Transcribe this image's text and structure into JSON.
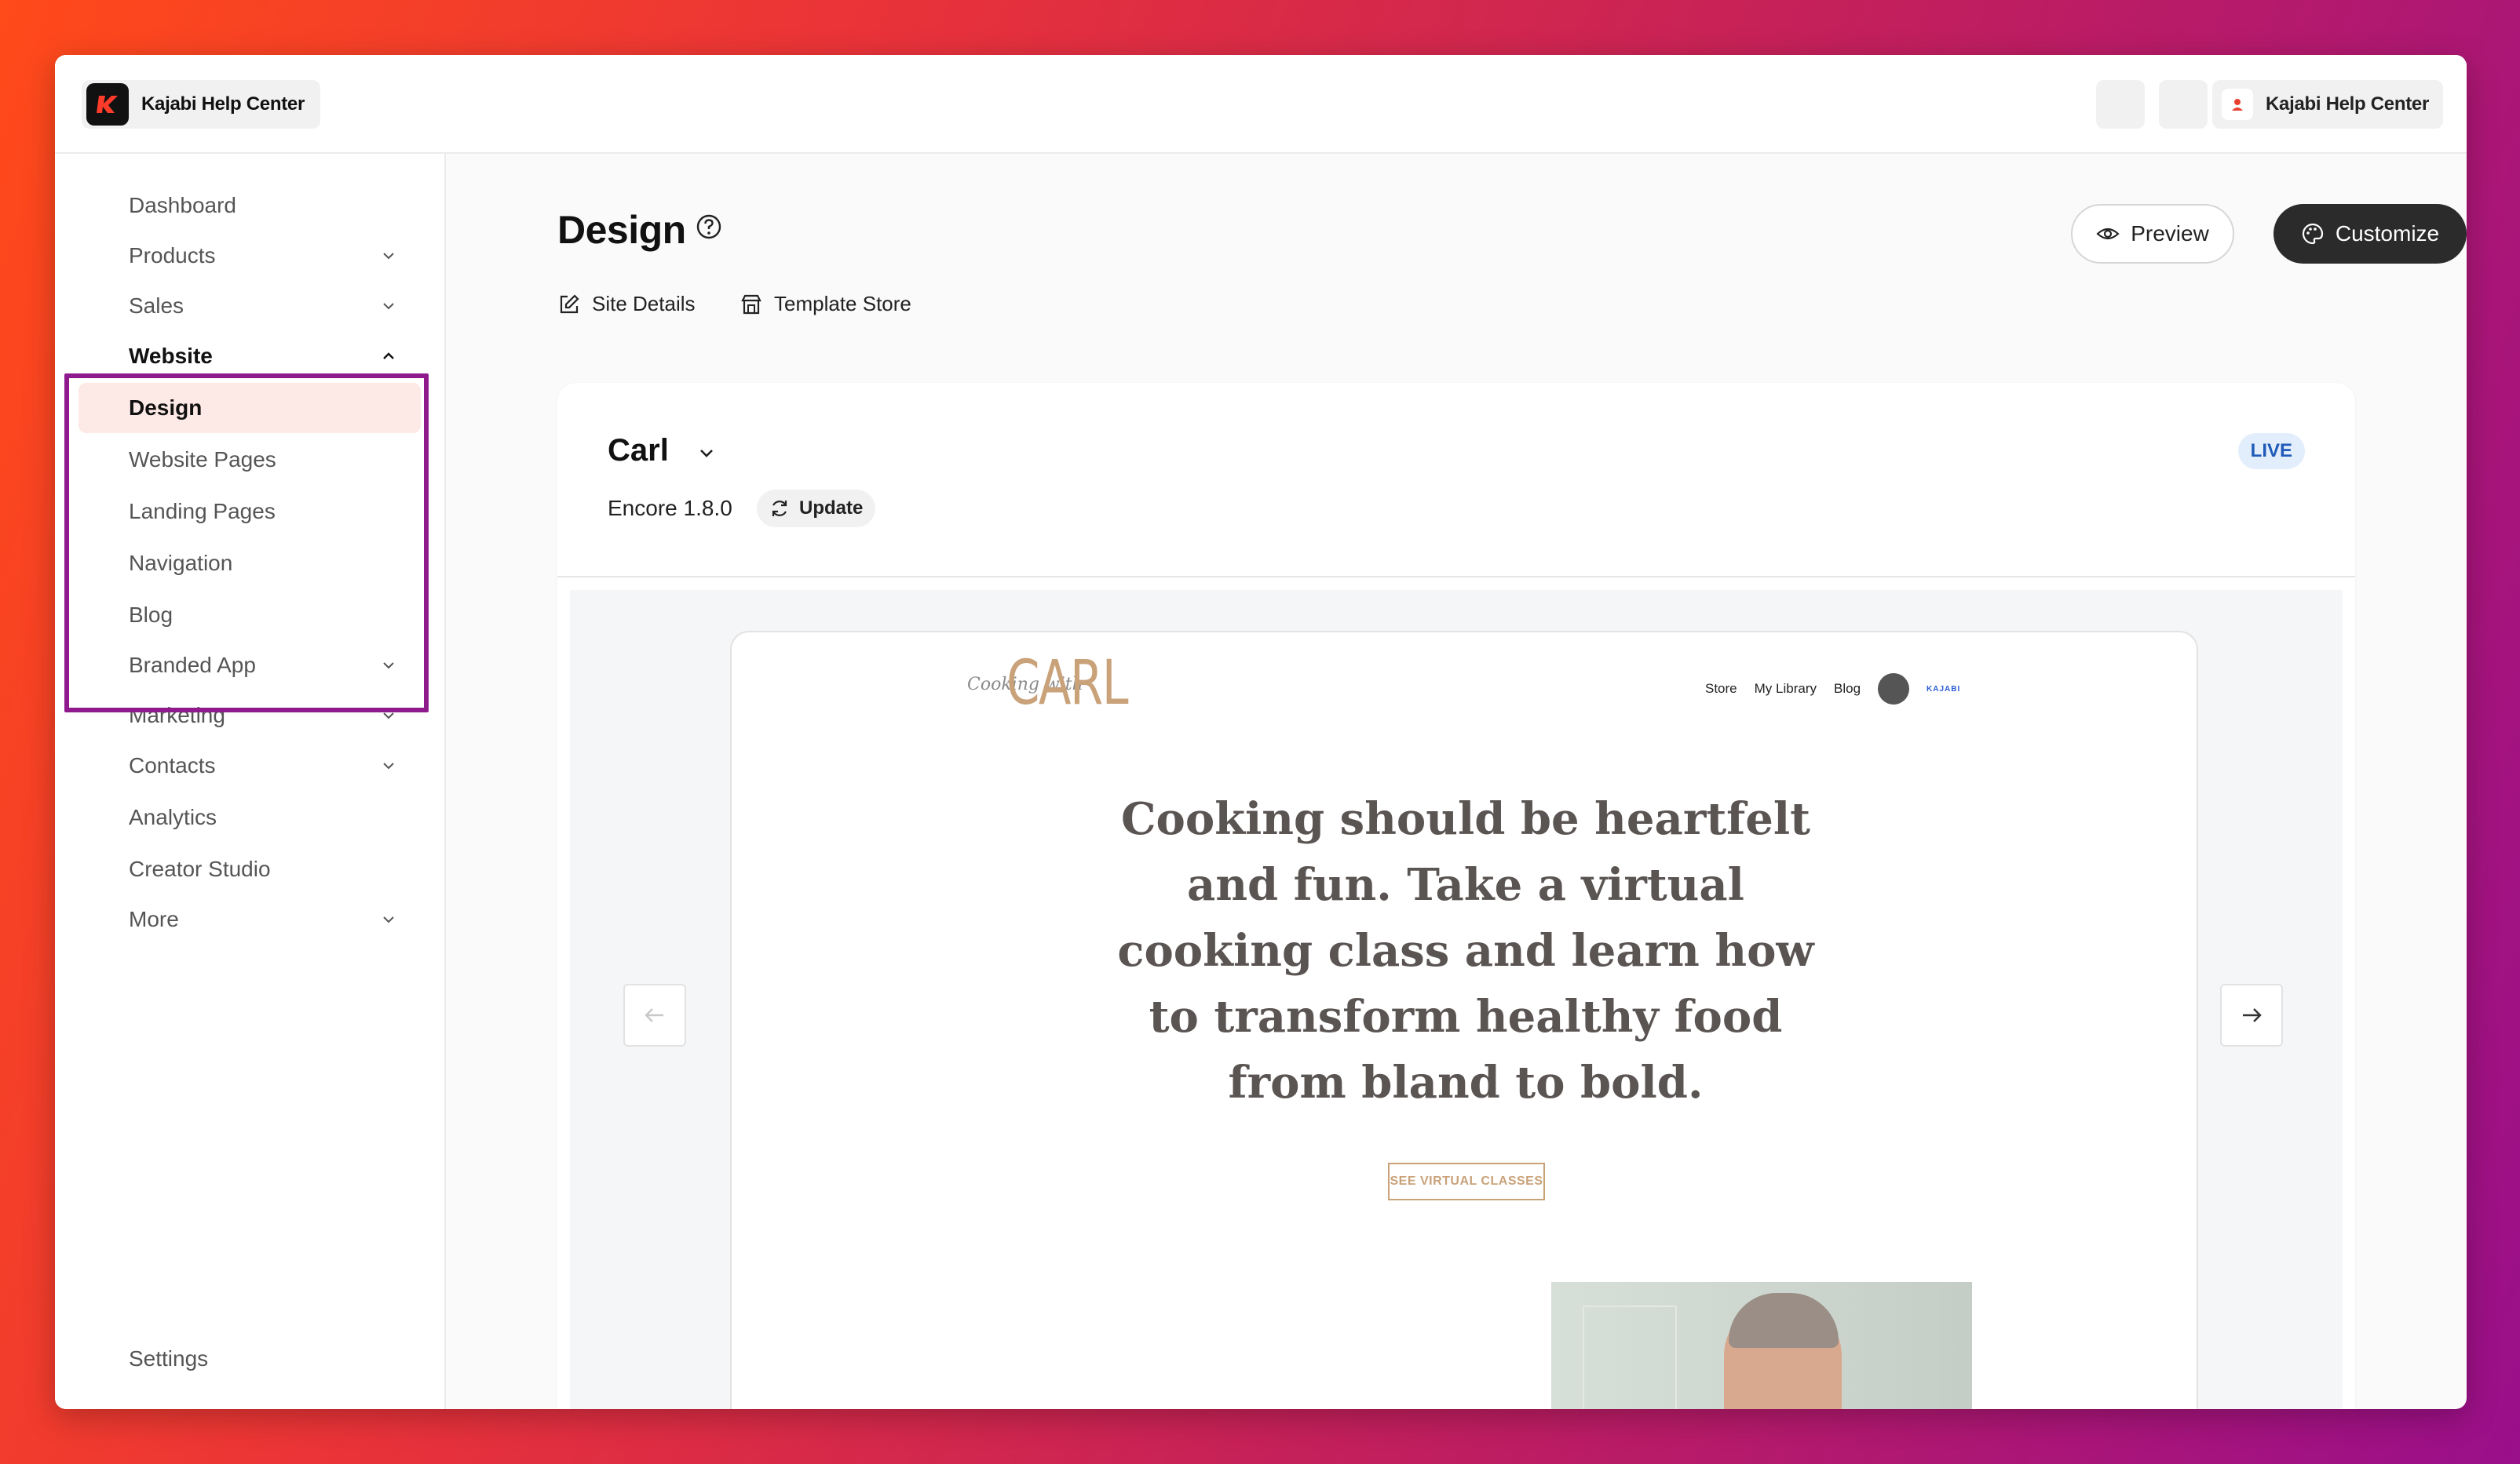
{
  "app": {
    "name": "Kajabi Help Center"
  },
  "topbar": {
    "user_name": "Kajabi Help Center"
  },
  "sidebar": {
    "items": [
      {
        "label": "Dashboard"
      },
      {
        "label": "Products"
      },
      {
        "label": "Sales"
      },
      {
        "label": "Website"
      },
      {
        "label": "Design"
      },
      {
        "label": "Website Pages"
      },
      {
        "label": "Landing Pages"
      },
      {
        "label": "Navigation"
      },
      {
        "label": "Blog"
      },
      {
        "label": "Branded App"
      },
      {
        "label": "Marketing"
      },
      {
        "label": "Contacts"
      },
      {
        "label": "Analytics"
      },
      {
        "label": "Creator Studio"
      },
      {
        "label": "More"
      },
      {
        "label": "Settings"
      }
    ]
  },
  "main": {
    "title": "Design",
    "preview_label": "Preview",
    "customize_label": "Customize",
    "links": {
      "site_details": "Site Details",
      "template_store": "Template Store"
    }
  },
  "theme": {
    "name": "Carl",
    "status": "LIVE",
    "version": "Encore 1.8.0",
    "update_label": "Update"
  },
  "site_preview": {
    "logo_script": "Cooking with",
    "logo_main": "CARL",
    "nav": [
      "Store",
      "My Library",
      "Blog"
    ],
    "badge": "KAJABI",
    "hero": "Cooking should be heartfelt and fun. Take a virtual cooking class and learn how to transform healthy food from bland to bold.",
    "cta": "SEE VIRTUAL CLASSES"
  },
  "colors": {
    "accent_selected_bg": "#fde9e6",
    "highlight_box": "#8e1a8e",
    "live_badge": "#1e5bb8",
    "site_gold": "#c9a27a"
  }
}
